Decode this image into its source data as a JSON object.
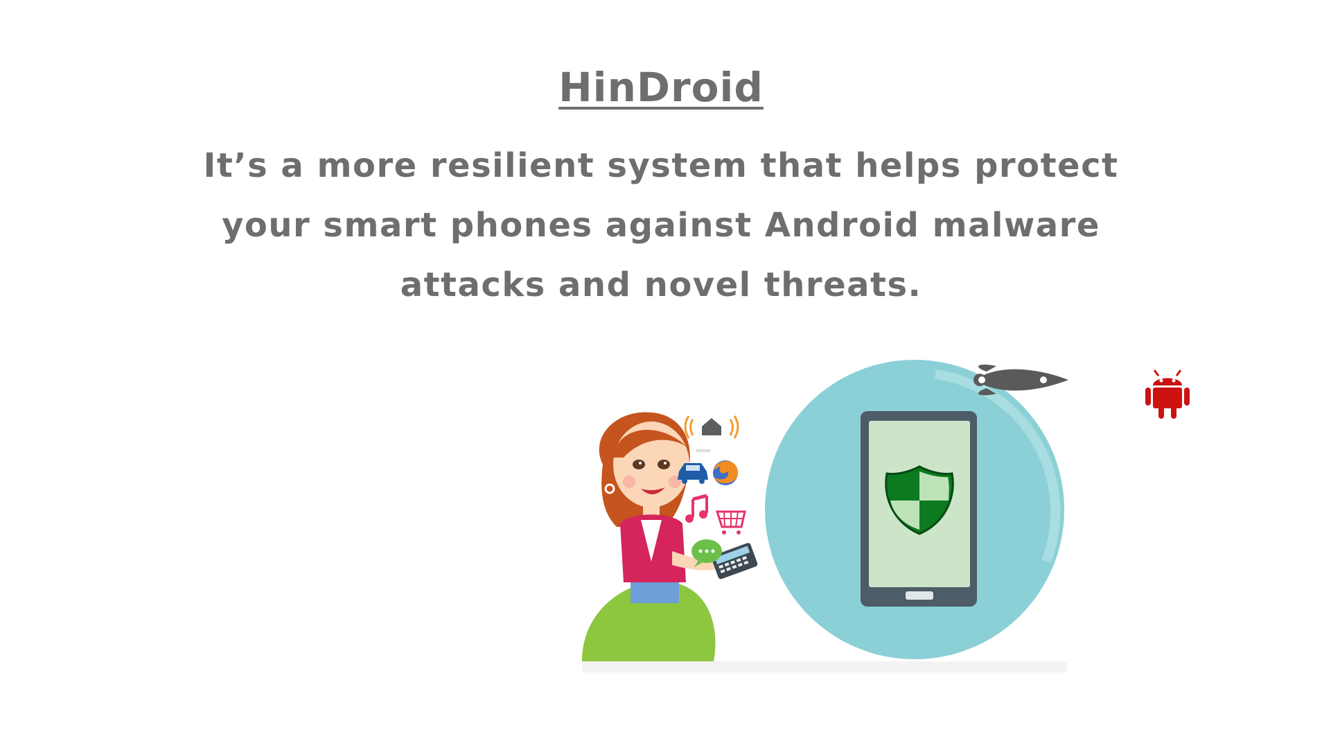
{
  "slide": {
    "title": "HinDroid",
    "subtitle": "It’s a more resilient system that helps protect your smart phones against Android malware attacks and novel threats."
  },
  "illustration": {
    "icons": [
      "woman-with-phone",
      "smart-home-icon",
      "car-icon",
      "firefox-icon",
      "music-note-icon",
      "shopping-cart-icon",
      "chat-bubble-icon",
      "phone-icon",
      "shield-icon",
      "rocket-icon",
      "android-icon"
    ],
    "colors": {
      "circle": "#8bd0d6",
      "phone_body": "#4d5c66",
      "screen": "#cce5c9",
      "shield": "#0c7a20",
      "rocket": "#5a5a5a",
      "android": "#cc1111",
      "text": "#6e6e6e"
    }
  }
}
